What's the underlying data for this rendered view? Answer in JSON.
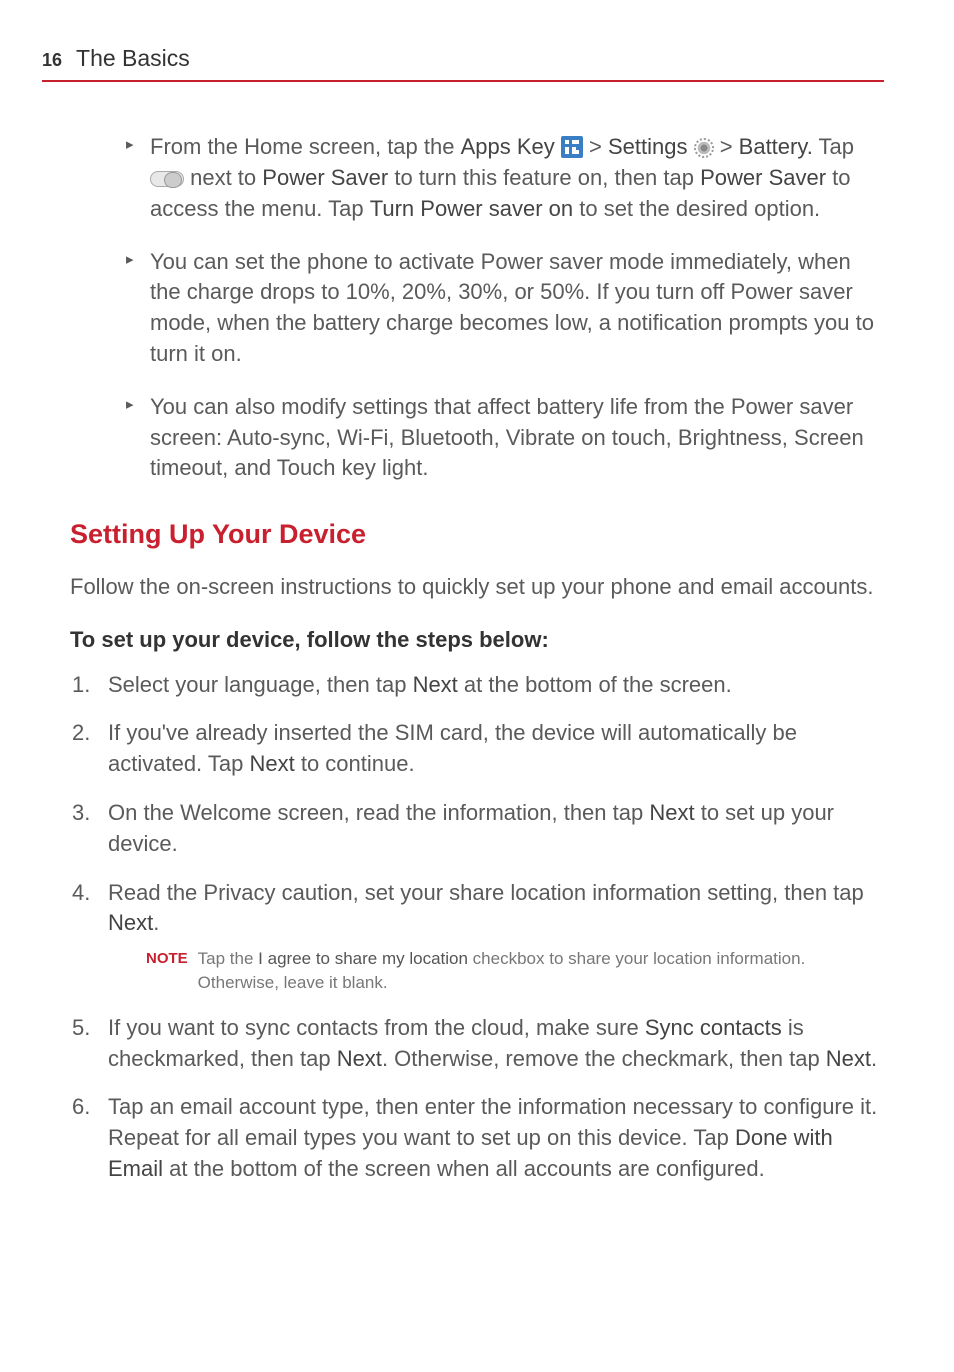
{
  "header": {
    "page_number": "16",
    "section": "The Basics"
  },
  "bullets": {
    "b1": {
      "t1": "From the Home screen, tap the ",
      "apps_key": "Apps Key",
      "t2": " > ",
      "settings": "Settings",
      "t3": " > ",
      "battery": "Battery.",
      "t4": " Tap ",
      "t5": " next to ",
      "power_saver": "Power Saver",
      "t6": " to turn this feature on, then tap ",
      "power_saver2": "Power Saver",
      "t7": " to access the menu. Tap ",
      "turn_on": "Turn Power saver on",
      "t8": " to set the desired option."
    },
    "b2": "You can set the phone to activate Power saver mode immediately, when the charge drops to 10%, 20%, 30%, or 50%. If you turn off Power saver mode, when the battery charge becomes low, a notification prompts you to turn it on.",
    "b3": "You can also modify settings that affect battery life from the Power saver screen: Auto-sync, Wi-Fi, Bluetooth, Vibrate on touch, Brightness, Screen timeout, and Touch key light."
  },
  "heading": "Setting Up Your Device",
  "intro": "Follow the on-screen instructions to quickly set up your phone and email accounts.",
  "subheading": "To set up your device, follow the steps below:",
  "steps": {
    "s1": {
      "a": "Select your language, then tap ",
      "b": "Next",
      "c": " at the bottom of the screen."
    },
    "s2": {
      "a": "If you've already inserted the SIM card, the device will automatically be activated. Tap ",
      "b": "Next",
      "c": " to continue."
    },
    "s3": {
      "a": "On the Welcome screen, read the information, then tap ",
      "b": "Next",
      "c": " to set up your device."
    },
    "s4": {
      "a": "Read the Privacy caution, set your share location information setting, then tap ",
      "b": "Next",
      "c": "."
    },
    "s5": {
      "a": "If you want to sync contacts from the cloud, make sure ",
      "b": "Sync contacts",
      "c": " is checkmarked, then tap ",
      "d": "Next",
      "e": ". Otherwise, remove the checkmark, then tap ",
      "f": "Next",
      "g": "."
    },
    "s6": {
      "a": "Tap an email account type, then enter the information necessary to configure it. Repeat for all email types you want to set up on this device. Tap ",
      "b": "Done with Email",
      "c": " at the bottom of the screen when all accounts are configured."
    }
  },
  "note": {
    "label": "NOTE",
    "a": "Tap the ",
    "b": "I agree to share my location",
    "c": " checkbox to share your location information. Otherwise, leave it blank."
  }
}
